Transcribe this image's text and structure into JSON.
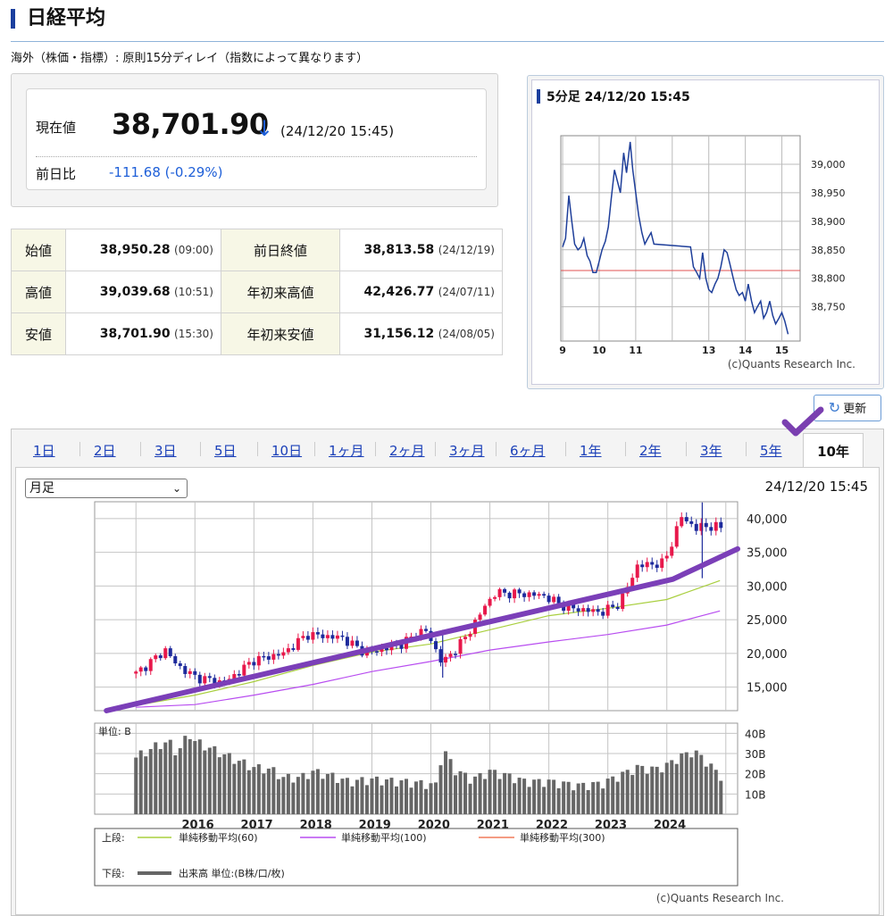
{
  "header": {
    "title": "日経平均",
    "notice": "海外（株価・指標）: 原則15分ディレイ（指数によって異なります）"
  },
  "quote": {
    "price_label": "現在値",
    "price": "38,701.90",
    "arrow": "↓",
    "time": "(24/12/20 15:45)",
    "change_label": "前日比",
    "change": "-111.68 (-0.29%)"
  },
  "stats": [
    {
      "label": "始値",
      "value": "38,950.28",
      "time": "(09:00)",
      "label2": "前日終値",
      "value2": "38,813.58",
      "time2": "(24/12/19)"
    },
    {
      "label": "高値",
      "value": "39,039.68",
      "time": "(10:51)",
      "label2": "年初来高値",
      "value2": "42,426.77",
      "time2": "(24/07/11)"
    },
    {
      "label": "安値",
      "value": "38,701.90",
      "time": "(15:30)",
      "label2": "年初来安値",
      "value2": "31,156.12",
      "time2": "(24/08/05)"
    }
  ],
  "intraday": {
    "title": "5分足 24/12/20 15:45",
    "credit": "(c)Quants Research Inc."
  },
  "refresh_label": "更新",
  "tabs": [
    "1日",
    "2日",
    "3日",
    "5日",
    "10日",
    "1ヶ月",
    "2ヶ月",
    "3ヶ月",
    "6ヶ月",
    "1年",
    "2年",
    "3年",
    "5年",
    "10年"
  ],
  "active_tab": "10年",
  "period_select": {
    "value": "月足"
  },
  "chart_time": "24/12/20 15:45",
  "legend": {
    "upper_label": "上段:",
    "lower_label": "下段:",
    "ma60": "単純移動平均(60)",
    "ma100": "単純移動平均(100)",
    "ma300": "単純移動平均(300)",
    "volume": "出来高 単位:(B株/口/枚)"
  },
  "volume_unit": "単位: B",
  "credit": "(c)Quants Research Inc.",
  "colors": {
    "up": "#e8184b",
    "down": "#1d2a9c",
    "ma60": "#a9cf3f",
    "ma100": "#b84df0",
    "ma300": "#f07a5a",
    "volume": "#666666",
    "trendline": "#7b3fb8",
    "intraday_line": "#1f3f9a",
    "prev_close": "#e05050",
    "link": "#1a3fb8"
  },
  "chart_data": [
    {
      "type": "line",
      "title": "5分足 24/12/20 15:45",
      "x_ticks": [
        "9",
        "10",
        "11",
        "13",
        "14",
        "15"
      ],
      "y_ticks": [
        39000,
        38950,
        38900,
        38850,
        38800,
        38750
      ],
      "ylim": [
        38690,
        39050
      ],
      "reference_line": 38813.58,
      "series": [
        {
          "points": [
            [
              9.0,
              38855
            ],
            [
              9.08,
              38870
            ],
            [
              9.17,
              38945
            ],
            [
              9.25,
              38900
            ],
            [
              9.33,
              38860
            ],
            [
              9.42,
              38850
            ],
            [
              9.5,
              38855
            ],
            [
              9.58,
              38870
            ],
            [
              9.67,
              38840
            ],
            [
              9.75,
              38830
            ],
            [
              9.83,
              38810
            ],
            [
              9.92,
              38810
            ],
            [
              10.0,
              38830
            ],
            [
              10.08,
              38850
            ],
            [
              10.17,
              38865
            ],
            [
              10.25,
              38890
            ],
            [
              10.33,
              38940
            ],
            [
              10.42,
              38990
            ],
            [
              10.5,
              38970
            ],
            [
              10.58,
              38950
            ],
            [
              10.67,
              39020
            ],
            [
              10.75,
              38985
            ],
            [
              10.85,
              39039
            ],
            [
              10.92,
              38990
            ],
            [
              11.0,
              38950
            ],
            [
              11.08,
              38910
            ],
            [
              11.17,
              38880
            ],
            [
              11.25,
              38860
            ],
            [
              11.33,
              38870
            ],
            [
              11.42,
              38880
            ],
            [
              11.5,
              38860
            ],
            [
              12.5,
              38855
            ],
            [
              12.58,
              38820
            ],
            [
              12.67,
              38810
            ],
            [
              12.75,
              38800
            ],
            [
              12.83,
              38845
            ],
            [
              12.92,
              38800
            ],
            [
              13.0,
              38780
            ],
            [
              13.08,
              38775
            ],
            [
              13.17,
              38790
            ],
            [
              13.25,
              38800
            ],
            [
              13.33,
              38820
            ],
            [
              13.42,
              38850
            ],
            [
              13.5,
              38845
            ],
            [
              13.58,
              38825
            ],
            [
              13.67,
              38800
            ],
            [
              13.75,
              38780
            ],
            [
              13.83,
              38770
            ],
            [
              13.92,
              38775
            ],
            [
              14.0,
              38760
            ],
            [
              14.08,
              38790
            ],
            [
              14.17,
              38760
            ],
            [
              14.25,
              38740
            ],
            [
              14.33,
              38750
            ],
            [
              14.42,
              38760
            ],
            [
              14.5,
              38730
            ],
            [
              14.58,
              38740
            ],
            [
              14.67,
              38760
            ],
            [
              14.75,
              38735
            ],
            [
              14.83,
              38720
            ],
            [
              14.92,
              38730
            ],
            [
              15.0,
              38740
            ],
            [
              15.08,
              38725
            ],
            [
              15.17,
              38702
            ]
          ]
        }
      ]
    },
    {
      "type": "candlestick",
      "period": "月足",
      "x_ticks": [
        "2016",
        "2017",
        "2018",
        "2019",
        "2020",
        "2021",
        "2022",
        "2023",
        "2024"
      ],
      "y_ticks": [
        40000,
        35000,
        30000,
        25000,
        20000,
        15000
      ],
      "ylim": [
        11500,
        42500
      ],
      "volume_ticks": [
        "40B",
        "30B",
        "20B",
        "10B"
      ],
      "volume_max": 45,
      "series": [
        {
          "name": "単純移動平均(60)",
          "points": [
            [
              2015.0,
              12300
            ],
            [
              2016.0,
              13800
            ],
            [
              2017.0,
              15800
            ],
            [
              2018.0,
              18200
            ],
            [
              2019.0,
              20200
            ],
            [
              2020.0,
              21400
            ],
            [
              2021.0,
              23500
            ],
            [
              2022.0,
              25600
            ],
            [
              2023.0,
              26700
            ],
            [
              2024.0,
              28000
            ],
            [
              2024.9,
              30800
            ]
          ]
        },
        {
          "name": "単純移動平均(100)",
          "points": [
            [
              2015.0,
              12000
            ],
            [
              2016.0,
              12400
            ],
            [
              2017.0,
              13800
            ],
            [
              2018.0,
              15400
            ],
            [
              2019.0,
              17300
            ],
            [
              2020.0,
              18800
            ],
            [
              2021.0,
              20500
            ],
            [
              2022.0,
              21700
            ],
            [
              2023.0,
              22800
            ],
            [
              2024.0,
              24200
            ],
            [
              2024.9,
              26300
            ]
          ]
        },
        {
          "name": "trendline",
          "points": [
            [
              2014.5,
              11500
            ],
            [
              2024.1,
              31000
            ],
            [
              2025.2,
              35500
            ]
          ]
        }
      ],
      "anchors": [
        [
          2015.0,
          17000
        ],
        [
          2015.5,
          20500
        ],
        [
          2015.7,
          18200
        ],
        [
          2016.0,
          16500
        ],
        [
          2016.5,
          15600
        ],
        [
          2017.0,
          19000
        ],
        [
          2017.5,
          20000
        ],
        [
          2017.9,
          22800
        ],
        [
          2018.5,
          22300
        ],
        [
          2018.9,
          20000
        ],
        [
          2019.5,
          21400
        ],
        [
          2019.9,
          23600
        ],
        [
          2020.2,
          18500
        ],
        [
          2020.6,
          22500
        ],
        [
          2020.95,
          27500
        ],
        [
          2021.1,
          29000
        ],
        [
          2021.6,
          28800
        ],
        [
          2021.9,
          28600
        ],
        [
          2022.3,
          26800
        ],
        [
          2022.9,
          26100
        ],
        [
          2023.2,
          27400
        ],
        [
          2023.5,
          33000
        ],
        [
          2023.95,
          33400
        ],
        [
          2024.1,
          36800
        ],
        [
          2024.25,
          40300
        ],
        [
          2024.5,
          38500
        ],
        [
          2024.6,
          38900
        ],
        [
          2024.9,
          38700
        ]
      ],
      "volume_anchors": [
        [
          2015.0,
          28
        ],
        [
          2015.3,
          33
        ],
        [
          2015.55,
          36
        ],
        [
          2015.7,
          30
        ],
        [
          2015.9,
          40
        ],
        [
          2016.0,
          36
        ],
        [
          2016.3,
          32
        ],
        [
          2016.6,
          28
        ],
        [
          2017.0,
          23
        ],
        [
          2017.3,
          22
        ],
        [
          2017.5,
          18
        ],
        [
          2017.8,
          18
        ],
        [
          2018.0,
          21
        ],
        [
          2018.3,
          19
        ],
        [
          2018.6,
          16
        ],
        [
          2019.0,
          17
        ],
        [
          2019.5,
          16
        ],
        [
          2019.9,
          15
        ],
        [
          2020.1,
          14
        ],
        [
          2020.2,
          33
        ],
        [
          2020.4,
          22
        ],
        [
          2020.7,
          17
        ],
        [
          2021.0,
          21
        ],
        [
          2021.3,
          19
        ],
        [
          2021.6,
          16
        ],
        [
          2022.0,
          16
        ],
        [
          2022.5,
          14
        ],
        [
          2022.9,
          15
        ],
        [
          2023.2,
          19
        ],
        [
          2023.5,
          23
        ],
        [
          2023.8,
          22
        ],
        [
          2024.0,
          24
        ],
        [
          2024.2,
          28
        ],
        [
          2024.45,
          31
        ],
        [
          2024.6,
          28
        ],
        [
          2024.9,
          19
        ]
      ]
    }
  ]
}
